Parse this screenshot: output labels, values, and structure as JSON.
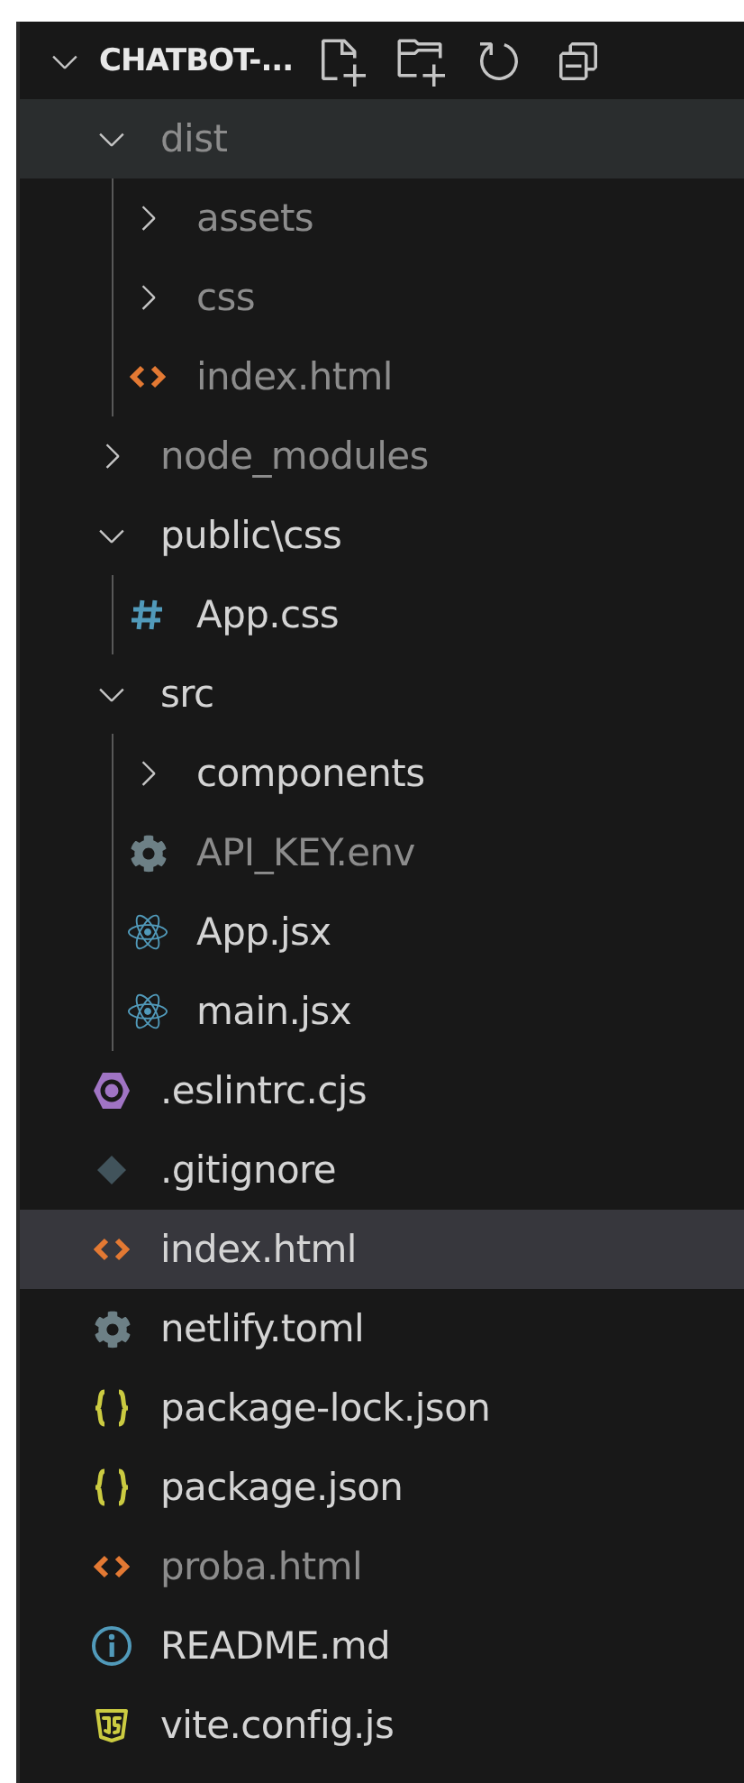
{
  "explorer": {
    "title": "CHATBOT-...",
    "expanded": true
  },
  "tree": [
    {
      "name": "dist",
      "kind": "folder",
      "expanded": true,
      "dimmed": true,
      "selected": false,
      "hovered": true,
      "children": [
        {
          "name": "assets",
          "kind": "folder",
          "expanded": false,
          "dimmed": true,
          "selected": false,
          "hovered": false
        },
        {
          "name": "css",
          "kind": "folder",
          "expanded": false,
          "dimmed": true,
          "selected": false,
          "hovered": false
        },
        {
          "name": "index.html",
          "kind": "html",
          "dimmed": true,
          "selected": false,
          "hovered": false
        }
      ]
    },
    {
      "name": "node_modules",
      "kind": "folder",
      "expanded": false,
      "dimmed": true,
      "selected": false,
      "hovered": false
    },
    {
      "name": "public\\css",
      "kind": "folder",
      "expanded": true,
      "dimmed": false,
      "selected": false,
      "hovered": false,
      "children": [
        {
          "name": "App.css",
          "kind": "css",
          "dimmed": false,
          "selected": false,
          "hovered": false
        }
      ]
    },
    {
      "name": "src",
      "kind": "folder",
      "expanded": true,
      "dimmed": false,
      "selected": false,
      "hovered": false,
      "children": [
        {
          "name": "components",
          "kind": "folder",
          "expanded": false,
          "dimmed": false,
          "selected": false,
          "hovered": false
        },
        {
          "name": "API_KEY.env",
          "kind": "config",
          "dimmed": true,
          "selected": false,
          "hovered": false
        },
        {
          "name": "App.jsx",
          "kind": "react",
          "dimmed": false,
          "selected": false,
          "hovered": false
        },
        {
          "name": "main.jsx",
          "kind": "react",
          "dimmed": false,
          "selected": false,
          "hovered": false
        }
      ]
    },
    {
      "name": ".eslintrc.cjs",
      "kind": "eslint",
      "dimmed": false,
      "selected": false,
      "hovered": false
    },
    {
      "name": ".gitignore",
      "kind": "git",
      "dimmed": false,
      "selected": false,
      "hovered": false
    },
    {
      "name": "index.html",
      "kind": "html",
      "dimmed": false,
      "selected": true,
      "hovered": false
    },
    {
      "name": "netlify.toml",
      "kind": "config",
      "dimmed": false,
      "selected": false,
      "hovered": false
    },
    {
      "name": "package-lock.json",
      "kind": "json",
      "dimmed": false,
      "selected": false,
      "hovered": false
    },
    {
      "name": "package.json",
      "kind": "json",
      "dimmed": false,
      "selected": false,
      "hovered": false
    },
    {
      "name": "proba.html",
      "kind": "html",
      "dimmed": true,
      "selected": false,
      "hovered": false
    },
    {
      "name": "README.md",
      "kind": "info",
      "dimmed": false,
      "selected": false,
      "hovered": false
    },
    {
      "name": "vite.config.js",
      "kind": "js",
      "dimmed": false,
      "selected": false,
      "hovered": false
    }
  ]
}
